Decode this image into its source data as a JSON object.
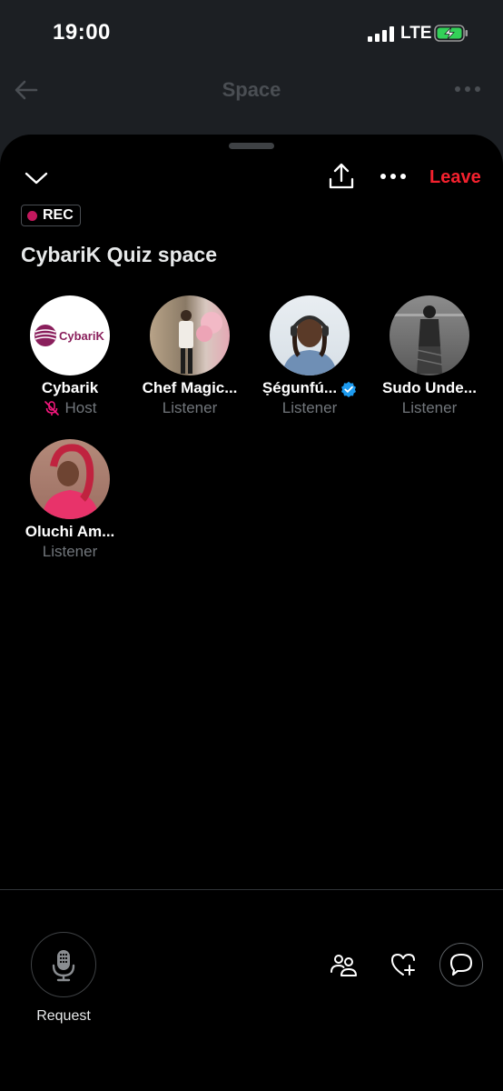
{
  "status_bar": {
    "time": "19:00",
    "network": "LTE"
  },
  "background_nav": {
    "title": "Space"
  },
  "sheet": {
    "leave_label": "Leave",
    "rec_label": "REC",
    "title": "CybariK Quiz space"
  },
  "participants": [
    {
      "name": "Cybarik",
      "role": "Host",
      "logo_text": "CybariK",
      "muted": true,
      "verified": false
    },
    {
      "name": "Chef Magic...",
      "role": "Listener",
      "verified": false
    },
    {
      "name": "Ṣégunfú...",
      "role": "Listener",
      "verified": true
    },
    {
      "name": "Sudo Unde...",
      "role": "Listener",
      "verified": false
    },
    {
      "name": "Oluchi Am...",
      "role": "Listener",
      "verified": false
    }
  ],
  "bottom_bar": {
    "request_label": "Request"
  },
  "colors": {
    "accent_red": "#f4212e",
    "rec_dot": "#c3185d",
    "host_pink": "#f91880",
    "verified_blue": "#1d9bf0",
    "secondary_text": "#71767b"
  },
  "icons": [
    "back-arrow-icon",
    "more-icon",
    "chevron-down-icon",
    "share-icon",
    "mic-muted-icon",
    "verified-badge-icon",
    "microphone-icon",
    "people-icon",
    "heart-plus-icon",
    "chat-bubble-icon"
  ]
}
